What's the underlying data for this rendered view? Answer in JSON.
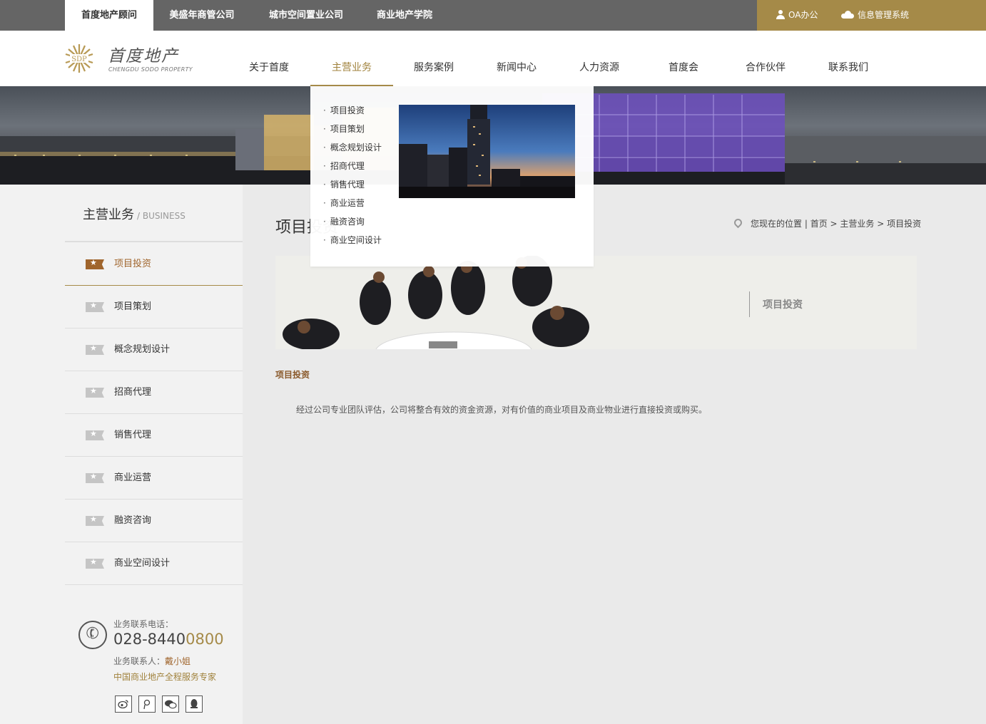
{
  "topbar": {
    "tabs": [
      "首度地产顾问",
      "美盛年商管公司",
      "城市空间置业公司",
      "商业地产学院"
    ],
    "oa": "OA办公",
    "info_system": "信息管理系统",
    "colors": {
      "bar": "#656565",
      "accent": "#a58a48"
    }
  },
  "header": {
    "logo_name": "首度地产",
    "logo_badge": "SDP",
    "logo_en": "CHENGDU SODO PROPERTY",
    "nav": [
      "关于首度",
      "主营业务",
      "服务案例",
      "新闻中心",
      "人力资源",
      "首度会",
      "合作伙伴",
      "联系我们"
    ],
    "active_nav": "主营业务"
  },
  "dropdown": {
    "items": [
      "项目投资",
      "项目策划",
      "概念规划设计",
      "招商代理",
      "销售代理",
      "商业运营",
      "融资咨询",
      "商业空间设计"
    ]
  },
  "sidebar": {
    "title": "主营业务",
    "title_en": "/ BUSINESS",
    "items": [
      "项目投资",
      "项目策划",
      "概念规划设计",
      "招商代理",
      "销售代理",
      "商业运营",
      "融资咨询",
      "商业空间设计"
    ],
    "active": "项目投资",
    "star": "★"
  },
  "contact": {
    "label": "业务联系电话：",
    "phone_prefix": "028-8440",
    "phone_suffix": "0800",
    "person_label": "业务联系人：",
    "person": "戴小姐",
    "slogan": "中国商业地产全程服务专家",
    "phone_glyph": "✆",
    "social": [
      "weibo-icon",
      "tencent-weibo-icon",
      "wechat-icon",
      "qq-icon"
    ]
  },
  "main": {
    "title": "项目投资",
    "breadcrumb": {
      "prefix": "您现在的位置 |",
      "home": "首页",
      "sep": ">",
      "section": "主营业务",
      "current": "项目投资"
    },
    "hero_label": "项目投资",
    "section_heading": "项目投资",
    "body": "经过公司专业团队评估，公司将整合有效的资金资源，对有价值的商业项目及商业物业进行直接投资或购买。"
  }
}
